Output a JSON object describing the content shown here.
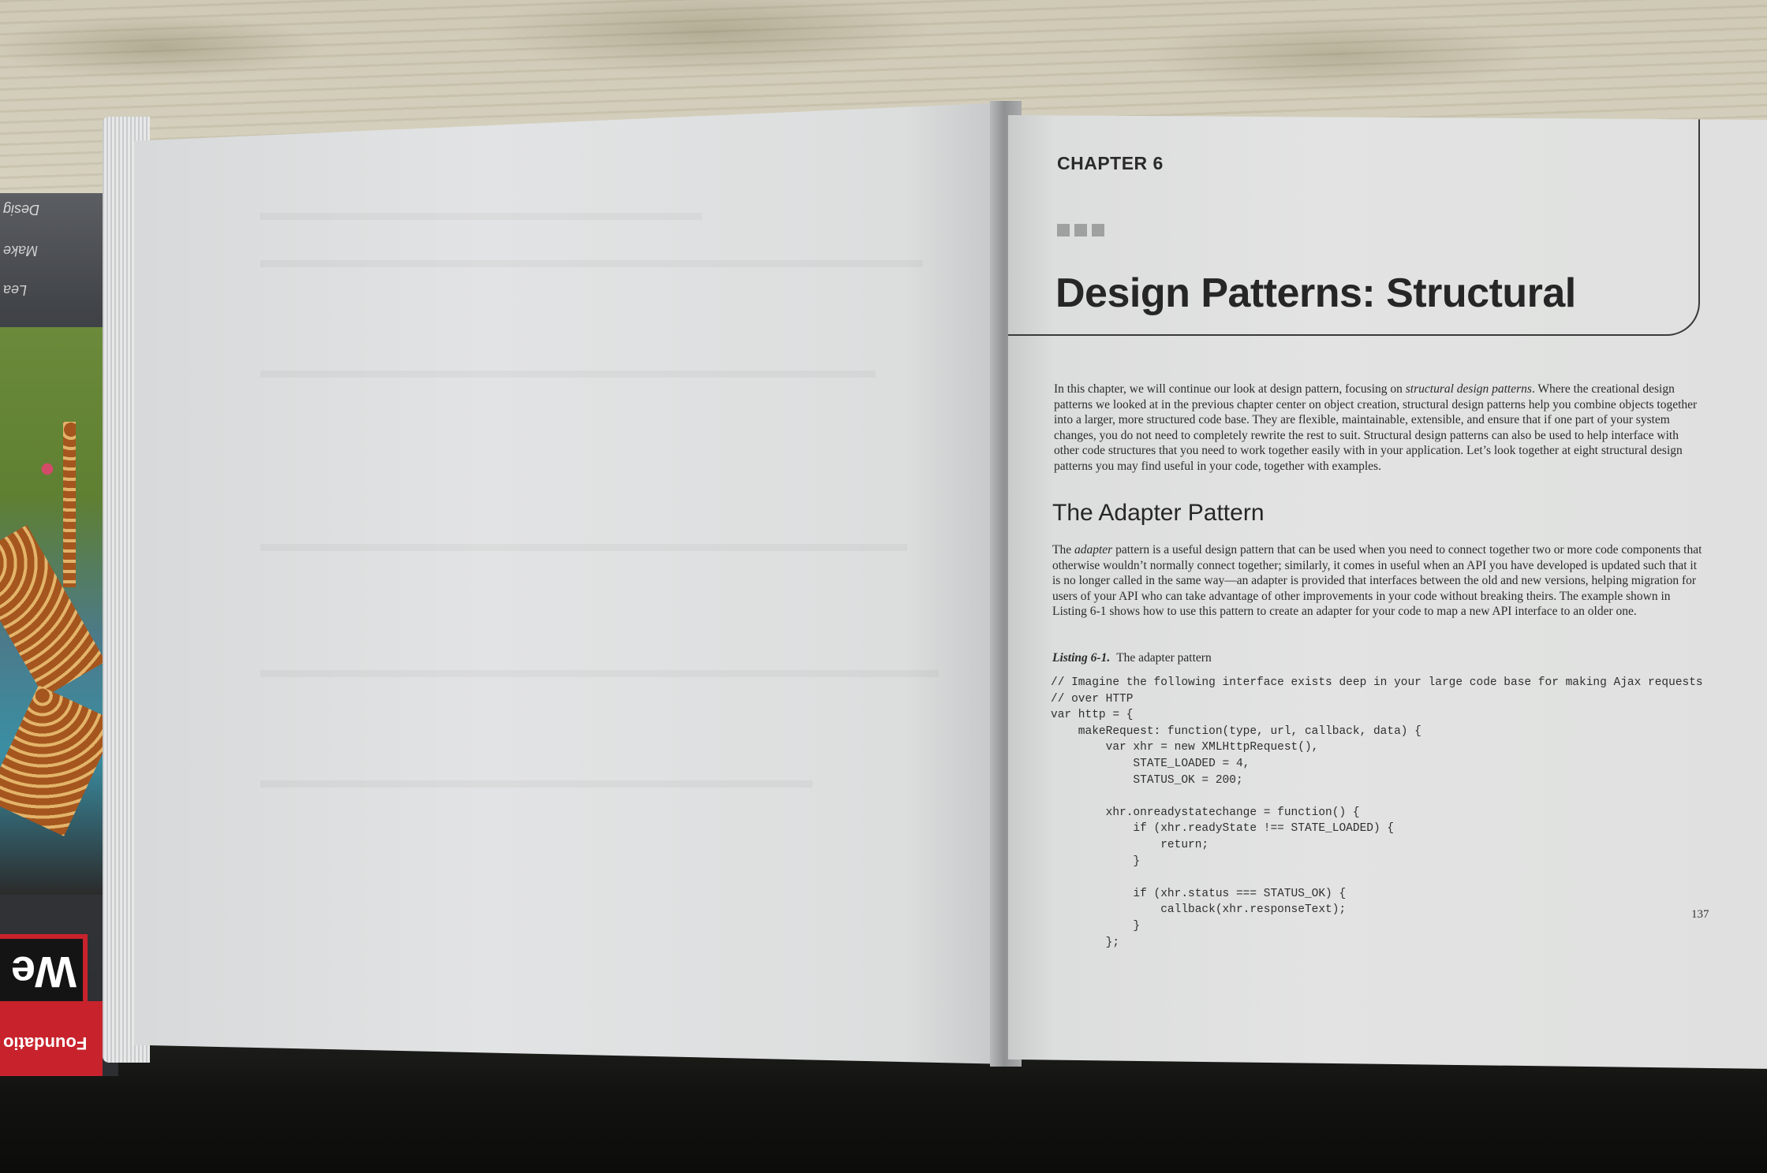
{
  "chapter": {
    "label": "CHAPTER 6",
    "title": "Design Patterns: Structural"
  },
  "intro": {
    "before_em": "In this chapter, we will continue our look at design pattern, focusing on ",
    "em": "structural design patterns",
    "after_em": ". Where the creational design patterns we looked at in the previous chapter center on object creation, structural design patterns help you combine objects together into a larger, more structured code base. They are flexible, maintainable, extensible, and ensure that if one part of your system changes, you do not need to completely rewrite the rest to suit. Structural design patterns can also be used to help interface with other code structures that you need to work together easily with in your application. Let’s look together at eight structural design patterns you may find useful in your code, together with examples."
  },
  "section": {
    "heading": "The Adapter Pattern",
    "before_em": "The ",
    "em": "adapter",
    "after_em": " pattern is a useful design pattern that can be used when you need to connect together two or more code components that otherwise wouldn’t normally connect together; similarly, it comes in useful when an API you have developed is updated such that it is no longer called in the same way—an adapter is provided that interfaces between the old and new versions, helping migration for users of your API who can take advantage of other improvements in your code without breaking theirs. The example shown in Listing 6-1 shows how to use this pattern to create an adapter for your code to map a new API interface to an older one."
  },
  "listing": {
    "label": "Listing 6-1.",
    "caption": "The adapter pattern",
    "code": "// Imagine the following interface exists deep in your large code base for making Ajax requests\n// over HTTP\nvar http = {\n    makeRequest: function(type, url, callback, data) {\n        var xhr = new XMLHttpRequest(),\n            STATE_LOADED = 4,\n            STATUS_OK = 200;\n\n        xhr.onreadystatechange = function() {\n            if (xhr.readyState !== STATE_LOADED) {\n                return;\n            }\n\n            if (xhr.status === STATUS_OK) {\n                callback(xhr.responseText);\n            }\n        };"
  },
  "page_number": "137",
  "under_book": {
    "spine_text_1": "Desig",
    "spine_text_2": "Make",
    "spine_text_3": "Lea",
    "cover_big_text": "We",
    "cover_band_text": "Foundatio"
  },
  "colors": {
    "surface": "#d6d2bf",
    "page": "#e2e3e2",
    "ink": "#262626",
    "cover_red": "#c8232c"
  }
}
